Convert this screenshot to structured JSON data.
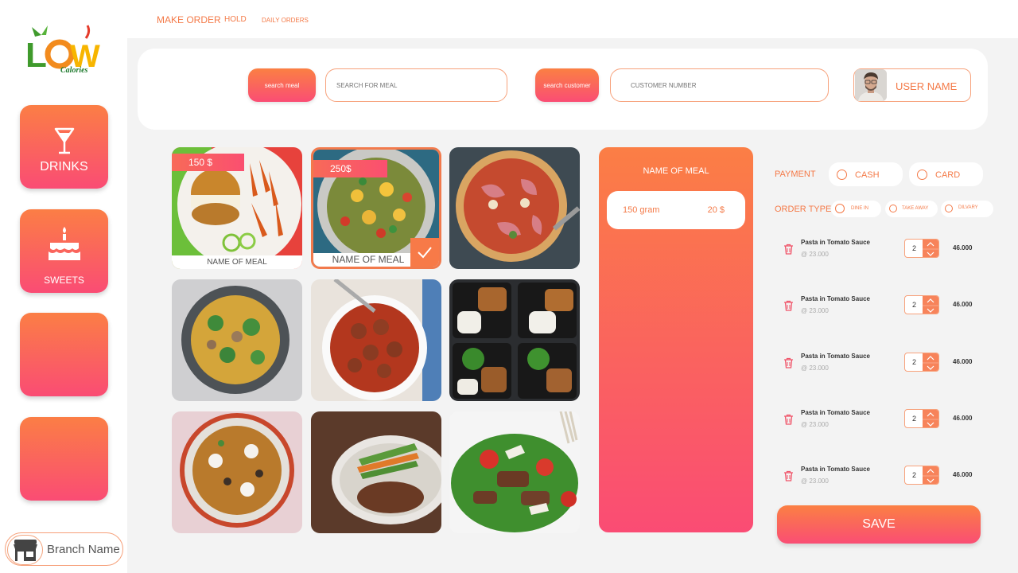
{
  "brand": {
    "logo_text": "LOW",
    "logo_sub": "Calories"
  },
  "nav": {
    "make_order": "MAKE ORDER",
    "hold": "HOLD",
    "daily_orders": "DAILY ORDERS"
  },
  "sidebar": {
    "items": [
      {
        "label": "DRINKS",
        "icon": "cocktail-glass-icon"
      },
      {
        "label": "SWEETS",
        "icon": "birthday-cake-icon"
      },
      {
        "label": "",
        "icon": ""
      },
      {
        "label": "",
        "icon": ""
      }
    ],
    "branch_name": "Branch Name"
  },
  "search": {
    "meal_button": "search meal",
    "meal_placeholder": "SEARCH FOR MEAL",
    "customer_button": "search customer",
    "customer_placeholder": "CUSTOMER NUMBER",
    "user_name": "USER NAME"
  },
  "meals": [
    {
      "price": "150 $",
      "name": "NAME OF MEAL"
    },
    {
      "price": "250$",
      "name": "NAME OF MEAL",
      "selected": true
    },
    {
      "price": "",
      "name": ""
    },
    {
      "price": "",
      "name": ""
    },
    {
      "price": "",
      "name": ""
    },
    {
      "price": "",
      "name": ""
    },
    {
      "price": "",
      "name": ""
    },
    {
      "price": "",
      "name": ""
    },
    {
      "price": "",
      "name": ""
    }
  ],
  "detail": {
    "title": "NAME OF MEAL",
    "weight": "150 gram",
    "price": "20 $"
  },
  "payment": {
    "label": "PAYMENT",
    "options": [
      "CASH",
      "CARD"
    ]
  },
  "order_type": {
    "label": "ORDER TYPE",
    "options": [
      "DINE IN",
      "TAKE AWAY",
      "DILVARY"
    ]
  },
  "order_items": [
    {
      "name": "Pasta in Tomato Sauce",
      "unit_price": "@ 23.000",
      "qty": "2",
      "total": "46.000"
    },
    {
      "name": "Pasta in Tomato Sauce",
      "unit_price": "@ 23.000",
      "qty": "2",
      "total": "46.000"
    },
    {
      "name": "Pasta in Tomato Sauce",
      "unit_price": "@ 23.000",
      "qty": "2",
      "total": "46.000"
    },
    {
      "name": "Pasta in Tomato Sauce",
      "unit_price": "@ 23.000",
      "qty": "2",
      "total": "46.000"
    },
    {
      "name": "Pasta in Tomato Sauce",
      "unit_price": "@ 23.000",
      "qty": "2",
      "total": "46.000"
    }
  ],
  "save_label": "SAVE",
  "colors": {
    "accent": "#f47a48",
    "gradient_top": "#fb7e45",
    "gradient_bottom": "#fa4c74"
  }
}
